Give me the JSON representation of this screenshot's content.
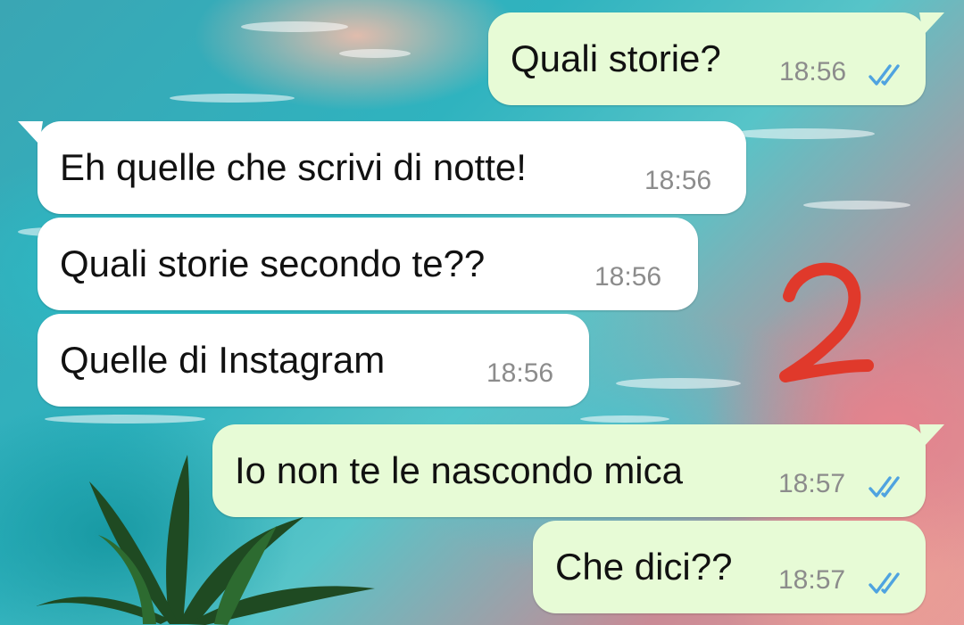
{
  "messages": [
    {
      "direction": "out",
      "text": "Quali storie?",
      "time": "18:56",
      "status": "read"
    },
    {
      "direction": "in",
      "text": "Eh quelle che scrivi di notte!",
      "time": "18:56"
    },
    {
      "direction": "in",
      "text": "Quali storie secondo te??",
      "time": "18:56"
    },
    {
      "direction": "in",
      "text": "Quelle di Instagram",
      "time": "18:56"
    },
    {
      "direction": "out",
      "text": "Io non te le nascondo mica",
      "time": "18:57",
      "status": "read"
    },
    {
      "direction": "out",
      "text": "Che dici??",
      "time": "18:57",
      "status": "read"
    }
  ],
  "annotation": "2",
  "colors": {
    "incoming_bubble": "#ffffff",
    "outgoing_bubble": "#e7fbd6",
    "read_ticks": "#4fa3e0",
    "timestamp": "#8c8c8c",
    "annotation": "#e0392b"
  },
  "icons": {
    "read_receipt": "double-check-icon"
  }
}
